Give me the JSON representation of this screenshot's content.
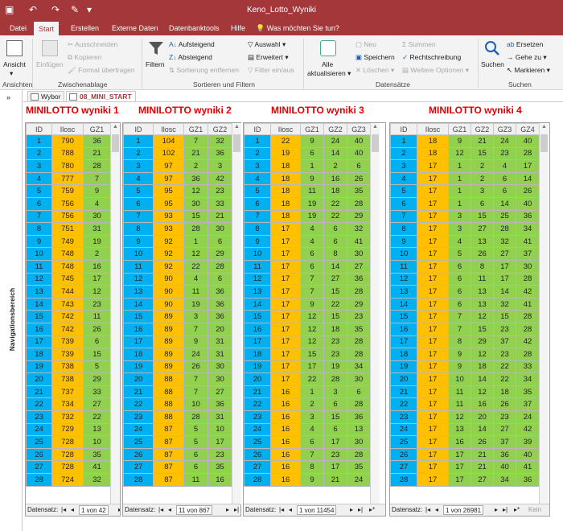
{
  "titlebar": {
    "title": "Keno_Lotto_Wyniki",
    "bg": "#a4373a"
  },
  "tabs": [
    "Datei",
    "Start",
    "Erstellen",
    "Externe Daten",
    "Datenbanktools",
    "Hilfe"
  ],
  "tellme": "Was möchten Sie tun?",
  "ribbon": {
    "views": {
      "label": "Ansicht",
      "group": "Ansichten"
    },
    "clipboard": {
      "paste": "Einfügen",
      "cut": "Ausschneiden",
      "copy": "Kopieren",
      "format": "Format übertragen",
      "group": "Zwischenablage"
    },
    "sort": {
      "filter": "Filtern",
      "asc": "Aufsteigend",
      "desc": "Absteigend",
      "remove": "Sortierung entfernen",
      "selection": "Auswahl",
      "advanced": "Erweitert",
      "toggle": "Filter ein/aus",
      "group": "Sortieren und Filtern"
    },
    "records": {
      "refresh1": "Alle",
      "refresh2": "aktualisieren",
      "new": "Neu",
      "save": "Speichern",
      "delete": "Löschen",
      "sums": "Summen",
      "spelling": "Rechtschreibung",
      "more": "Weitere Optionen",
      "group": "Datensätze"
    },
    "find": {
      "search": "Suchen",
      "replace": "Ersetzen",
      "goto": "Gehe zu",
      "select": "Markieren",
      "group": "Suchen"
    }
  },
  "navpane": {
    "label": "Navigationsbereich"
  },
  "doctabs": [
    "Wybor",
    "08_MINI_START"
  ],
  "colors": {
    "id": "#00b0f0",
    "ilosc": "#ffc000",
    "gz": "#92d050",
    "heading": "#e00000"
  },
  "recnav_label": "Datensatz:",
  "tables": [
    {
      "heading": "MINILOTTO wyniki 1",
      "columns": [
        "ID",
        "Ilosc",
        "GZ1"
      ],
      "record": "1 von 42",
      "rows": [
        [
          1,
          790,
          36
        ],
        [
          2,
          788,
          21
        ],
        [
          3,
          780,
          28
        ],
        [
          4,
          777,
          7
        ],
        [
          5,
          759,
          9
        ],
        [
          6,
          756,
          4
        ],
        [
          7,
          756,
          30
        ],
        [
          8,
          751,
          31
        ],
        [
          9,
          749,
          19
        ],
        [
          10,
          748,
          2
        ],
        [
          11,
          748,
          16
        ],
        [
          12,
          745,
          17
        ],
        [
          13,
          744,
          12
        ],
        [
          14,
          743,
          23
        ],
        [
          15,
          742,
          11
        ],
        [
          16,
          742,
          26
        ],
        [
          17,
          739,
          6
        ],
        [
          18,
          739,
          15
        ],
        [
          19,
          738,
          5
        ],
        [
          20,
          738,
          29
        ],
        [
          21,
          737,
          33
        ],
        [
          22,
          734,
          27
        ],
        [
          23,
          732,
          22
        ],
        [
          24,
          729,
          13
        ],
        [
          25,
          728,
          10
        ],
        [
          26,
          728,
          35
        ],
        [
          27,
          728,
          41
        ],
        [
          28,
          724,
          32
        ]
      ]
    },
    {
      "heading": "MINILOTTO wyniki 2",
      "columns": [
        "ID",
        "Ilosc",
        "GZ1",
        "GZ2"
      ],
      "record": "11 von 867",
      "rows": [
        [
          1,
          104,
          7,
          32
        ],
        [
          2,
          102,
          21,
          36
        ],
        [
          3,
          97,
          2,
          3
        ],
        [
          4,
          97,
          36,
          42
        ],
        [
          5,
          95,
          12,
          23
        ],
        [
          6,
          95,
          30,
          33
        ],
        [
          7,
          93,
          15,
          21
        ],
        [
          8,
          93,
          28,
          30
        ],
        [
          9,
          92,
          1,
          6
        ],
        [
          10,
          92,
          12,
          29
        ],
        [
          11,
          92,
          22,
          28
        ],
        [
          12,
          90,
          4,
          6
        ],
        [
          13,
          90,
          11,
          36
        ],
        [
          14,
          90,
          19,
          36
        ],
        [
          15,
          89,
          3,
          36
        ],
        [
          16,
          89,
          7,
          20
        ],
        [
          17,
          89,
          9,
          31
        ],
        [
          18,
          89,
          24,
          31
        ],
        [
          19,
          89,
          26,
          30
        ],
        [
          20,
          88,
          7,
          30
        ],
        [
          21,
          88,
          7,
          27
        ],
        [
          22,
          88,
          10,
          36
        ],
        [
          23,
          88,
          28,
          31
        ],
        [
          24,
          87,
          5,
          10
        ],
        [
          25,
          87,
          5,
          17
        ],
        [
          26,
          87,
          6,
          23
        ],
        [
          27,
          87,
          6,
          35
        ],
        [
          28,
          87,
          11,
          16
        ]
      ]
    },
    {
      "heading": "MINILOTTO wyniki 3",
      "columns": [
        "ID",
        "Ilosc",
        "GZ1",
        "GZ2",
        "GZ3"
      ],
      "record": "1 von 11454",
      "rows": [
        [
          1,
          22,
          9,
          24,
          40
        ],
        [
          2,
          19,
          6,
          14,
          40
        ],
        [
          3,
          18,
          1,
          2,
          6
        ],
        [
          4,
          18,
          9,
          16,
          26
        ],
        [
          5,
          18,
          11,
          18,
          35
        ],
        [
          6,
          18,
          19,
          22,
          28
        ],
        [
          7,
          18,
          19,
          22,
          29
        ],
        [
          8,
          17,
          4,
          6,
          32
        ],
        [
          9,
          17,
          4,
          6,
          41
        ],
        [
          10,
          17,
          6,
          8,
          30
        ],
        [
          11,
          17,
          6,
          14,
          27
        ],
        [
          12,
          17,
          7,
          27,
          36
        ],
        [
          13,
          17,
          7,
          15,
          28
        ],
        [
          14,
          17,
          9,
          22,
          29
        ],
        [
          15,
          17,
          12,
          15,
          23
        ],
        [
          16,
          17,
          12,
          18,
          35
        ],
        [
          17,
          17,
          12,
          23,
          28
        ],
        [
          18,
          17,
          15,
          23,
          28
        ],
        [
          19,
          17,
          17,
          19,
          34
        ],
        [
          20,
          17,
          22,
          28,
          30
        ],
        [
          21,
          16,
          1,
          3,
          6
        ],
        [
          22,
          16,
          2,
          6,
          28
        ],
        [
          23,
          16,
          3,
          15,
          36
        ],
        [
          24,
          16,
          4,
          6,
          13
        ],
        [
          25,
          16,
          6,
          17,
          30
        ],
        [
          26,
          16,
          7,
          23,
          28
        ],
        [
          27,
          16,
          8,
          17,
          35
        ],
        [
          28,
          16,
          9,
          21,
          24
        ]
      ]
    },
    {
      "heading": "MINILOTTO wyniki 4",
      "columns": [
        "ID",
        "Ilosc",
        "GZ1",
        "GZ2",
        "GZ3",
        "GZ4"
      ],
      "record": "1 von 26981",
      "extra": "Kein",
      "rows": [
        [
          1,
          18,
          9,
          21,
          24,
          40
        ],
        [
          2,
          18,
          12,
          15,
          23,
          28
        ],
        [
          3,
          17,
          1,
          2,
          4,
          17
        ],
        [
          4,
          17,
          1,
          2,
          6,
          14
        ],
        [
          5,
          17,
          1,
          3,
          6,
          26
        ],
        [
          6,
          17,
          1,
          6,
          14,
          40
        ],
        [
          7,
          17,
          3,
          15,
          25,
          36
        ],
        [
          8,
          17,
          3,
          27,
          28,
          34
        ],
        [
          9,
          17,
          4,
          13,
          32,
          41
        ],
        [
          10,
          17,
          5,
          26,
          27,
          37
        ],
        [
          11,
          17,
          6,
          8,
          17,
          30
        ],
        [
          12,
          17,
          6,
          11,
          17,
          28
        ],
        [
          13,
          17,
          6,
          13,
          14,
          42
        ],
        [
          14,
          17,
          6,
          13,
          32,
          41
        ],
        [
          15,
          17,
          7,
          12,
          15,
          28
        ],
        [
          16,
          17,
          7,
          15,
          23,
          28
        ],
        [
          17,
          17,
          8,
          29,
          37,
          42
        ],
        [
          18,
          17,
          9,
          12,
          23,
          28
        ],
        [
          19,
          17,
          9,
          18,
          22,
          33
        ],
        [
          20,
          17,
          10,
          14,
          22,
          34
        ],
        [
          21,
          17,
          11,
          12,
          18,
          35
        ],
        [
          22,
          17,
          11,
          16,
          26,
          37
        ],
        [
          23,
          17,
          12,
          20,
          23,
          24
        ],
        [
          24,
          17,
          13,
          14,
          27,
          42
        ],
        [
          25,
          17,
          16,
          26,
          37,
          39
        ],
        [
          26,
          17,
          17,
          21,
          36,
          40
        ],
        [
          27,
          17,
          17,
          21,
          40,
          41
        ],
        [
          28,
          17,
          17,
          27,
          34,
          36
        ]
      ]
    }
  ]
}
